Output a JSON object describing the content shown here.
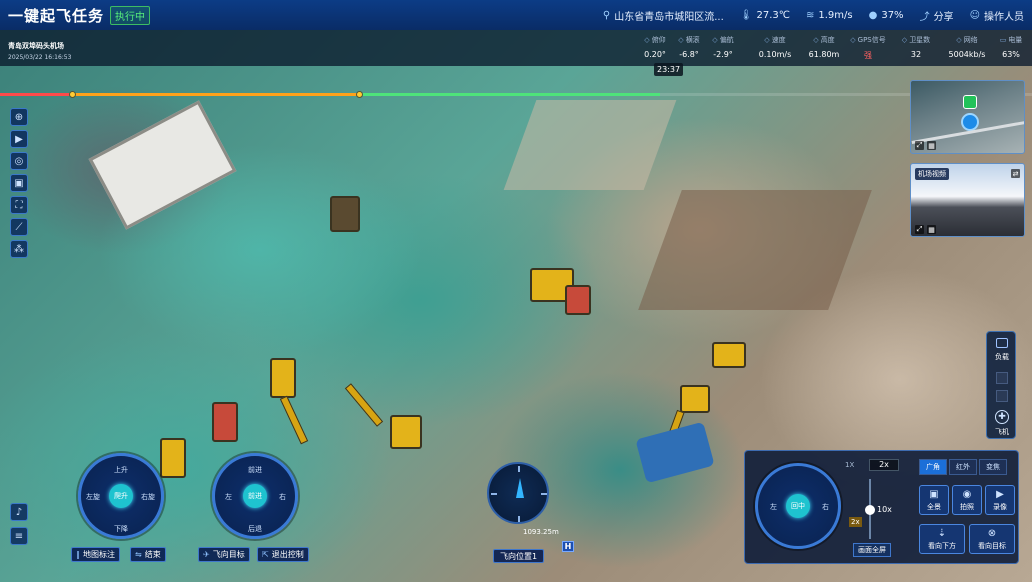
{
  "header": {
    "app_title": "一键起飞任务",
    "status_tag": "执行中",
    "location": "山东省青岛市城阳区流...",
    "temperature": "27.3℃",
    "wind_speed": "1.9m/s",
    "humidity": "37%",
    "share_label": "分享",
    "user_label": "操作人员"
  },
  "flight_info": {
    "site_name": "青岛双埠码头机场",
    "datetime": "2025/03/22 16:16:53",
    "telemetry": [
      {
        "label": "俯仰",
        "value": "0.20°"
      },
      {
        "label": "横滚",
        "value": "-6.8°"
      },
      {
        "label": "偏航",
        "value": "-2.9°"
      },
      {
        "label": "速度",
        "value": "0.10m/s"
      },
      {
        "label": "高度",
        "value": "61.80m"
      },
      {
        "label": "GPS信号",
        "value": "强"
      },
      {
        "label": "卫星数",
        "value": "32"
      },
      {
        "label": "网络",
        "value": "5004kb/s"
      },
      {
        "label": "电量",
        "value": "63%"
      }
    ],
    "timeline_time": "23:37"
  },
  "previews": {
    "map_label": "",
    "cam_label": "机场视频"
  },
  "right_panel": {
    "payload_label": "负载",
    "aircraft_label": "飞机"
  },
  "joystick_left": {
    "center": "爬升",
    "up": "上升",
    "down": "下降",
    "left": "左旋",
    "right": "右旋"
  },
  "joystick_right": {
    "center": "前进",
    "up": "前进",
    "down": "后退",
    "left": "左",
    "right": "右"
  },
  "bottom_buttons": {
    "map_mark": "地图标注",
    "end": "结束",
    "fly_target": "飞向目标",
    "exit_control": "退出控制"
  },
  "compass": {
    "distance": "1093.25m",
    "fly_position": "飞向位置1",
    "home_mark": "H"
  },
  "camera_panel": {
    "joystick": {
      "center": "回中",
      "left": "左",
      "right": "右"
    },
    "zoom_label": "1X",
    "zoom_value": "2x",
    "zoom_level": "10x",
    "zoom_small": "2x",
    "lens_button": "画面全屏",
    "tabs": [
      "广角",
      "红外",
      "变焦"
    ],
    "active_tab": "广角",
    "actions": [
      "全景",
      "拍照",
      "录像"
    ],
    "look_down": "看向下方",
    "look_target": "看向目标"
  }
}
